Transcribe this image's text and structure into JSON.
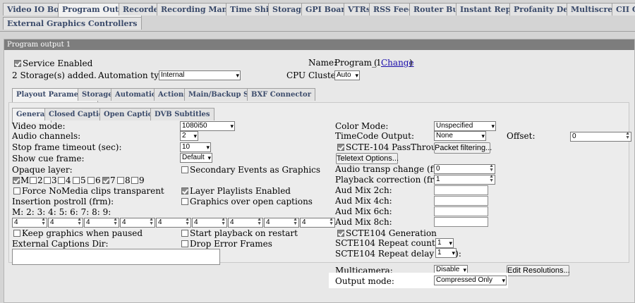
{
  "top_tabs_row1": [
    "Video IO Boards",
    "Program Outputs",
    "Recorders",
    "Recording Managers",
    "Time Shifts",
    "Storages",
    "GPI Boards",
    "VTRs",
    "RSS Feeds",
    "Router Buses",
    "Instant Replays",
    "Profanity Delays",
    "Multiscreens",
    "CII Gr"
  ],
  "top_tabs_row2": [
    "External Graphics Controllers"
  ],
  "panel_title": "Program output 1",
  "service_enabled_label": "Service Enabled",
  "storages_added": "2 Storage(s) added.",
  "automation_type_label": "Automation type:",
  "automation_type_value": "Internal",
  "name_label": "Name:",
  "name_value": "Program_1",
  "paren_open": "(",
  "change_link": "Change",
  "paren_close": ")",
  "cpu_cluster_label": "CPU Cluster:",
  "cpu_cluster_value": "Auto",
  "sub_tabs": [
    "Playout Parameters",
    "Storages",
    "Automation",
    "Actions",
    "Main/Backup Sync",
    "BXF Connector"
  ],
  "inner_tabs": [
    "General",
    "Closed Captions",
    "Open Captions",
    "DVB Subtitles"
  ],
  "left": {
    "video_mode_label": "Video mode:",
    "video_mode_value": "1080i50",
    "audio_channels_label": "Audio channels:",
    "audio_channels_value": "2",
    "stop_frame_label": "Stop frame timeout (sec):",
    "stop_frame_value": "10",
    "show_cue_label": "Show cue frame:",
    "show_cue_value": "Default",
    "opaque_label": "Opaque layer:",
    "opaque_items": [
      "M",
      "2",
      "3",
      "4",
      "5",
      "6",
      "7",
      "8",
      "9"
    ],
    "force_nomedia_label": "Force NoMedia clips transparent",
    "insertion_label": "Insertion postroll (frm):",
    "postroll_header": "M: 2: 3: 4: 5: 6: 7: 8: 9:",
    "postroll_values": [
      "4",
      "4",
      "4",
      "4",
      "4",
      "4",
      "4",
      "4",
      "4"
    ],
    "keep_graphics_label": "Keep graphics when paused",
    "ext_captions_label": "External Captions Dir:"
  },
  "middle": {
    "secondary_events_label": "Secondary Events as Graphics",
    "layer_playlists_label": "Layer Playlists Enabled",
    "graphics_over_label": "Graphics over open captions",
    "start_playback_label": "Start playback on restart",
    "drop_error_label": "Drop Error Frames"
  },
  "right": {
    "color_mode_label": "Color Mode:",
    "color_mode_value": "Unspecified",
    "timecode_label": "TimeCode Output:",
    "timecode_value": "None",
    "offset_label": "Offset:",
    "offset_value": "0",
    "scte_passthrough_label": "SCTE-104 PassThrough",
    "packet_filtering_btn": "Packet filtering...",
    "teletext_btn": "Teletext Options...",
    "audio_transp_label": "Audio transp change (frm):",
    "audio_transp_value": "0",
    "playback_corr_label": "Playback correction (frm):",
    "playback_corr_value": "1",
    "aud_mix_2_label": "Aud Mix 2ch:",
    "aud_mix_4_label": "Aud Mix 4ch:",
    "aud_mix_6_label": "Aud Mix 6ch:",
    "aud_mix_8_label": "Aud Mix 8ch:",
    "scte_gen_label": "SCTE104 Generation",
    "scte_repeat_count_label": "SCTE104 Repeat count:",
    "scte_repeat_count_value": "1",
    "scte_repeat_delay_label": "SCTE104 Repeat delay (frm):",
    "scte_repeat_delay_value": "1",
    "multicamera_label": "Multicamera:",
    "multicamera_value": "Disable",
    "edit_resolutions_btn": "Edit Resolutions...",
    "output_mode_label": "Output mode:",
    "output_mode_value": "Compressed Only"
  },
  "colors": {
    "tab_text": "#3a4a6a",
    "panel_title_bg": "#7d7d7d",
    "link": "#1a0dab"
  }
}
